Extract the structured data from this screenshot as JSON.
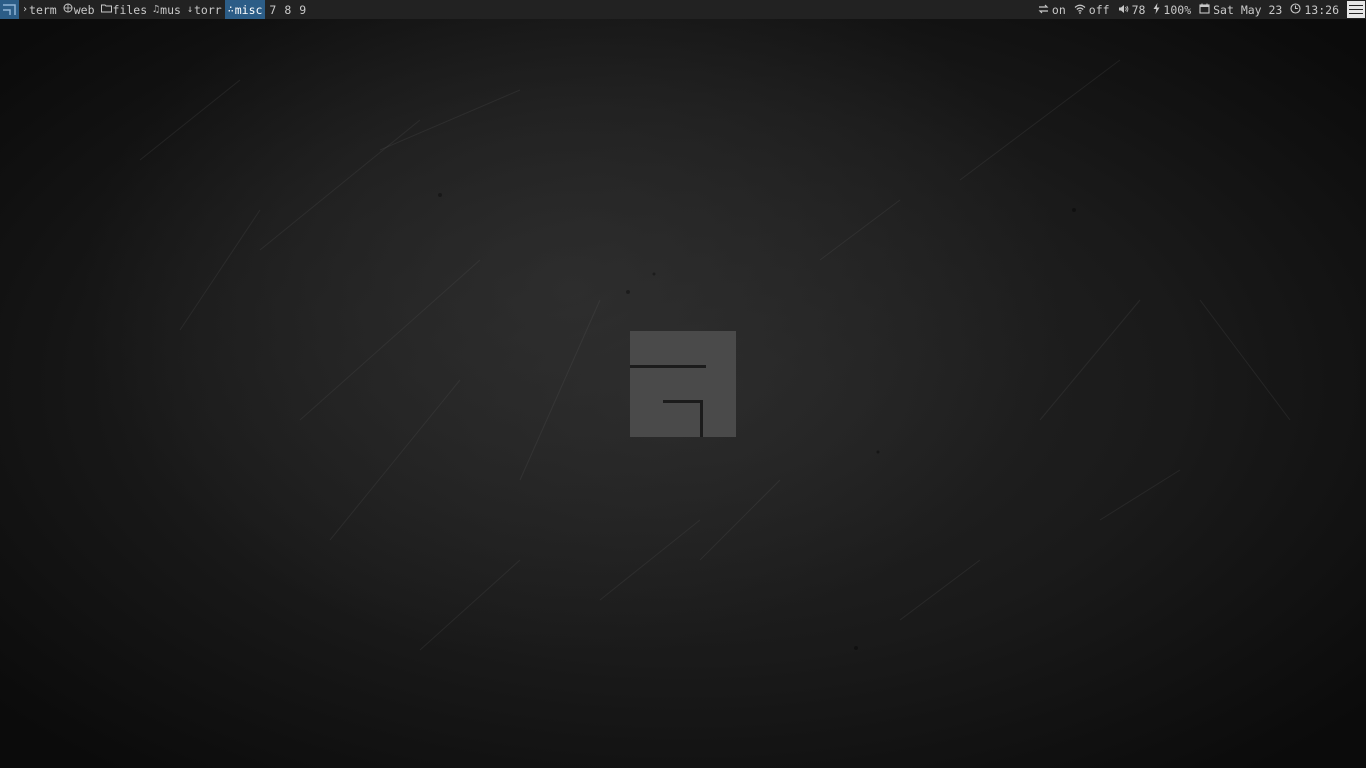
{
  "taskbar": {
    "tags": [
      {
        "label": "term",
        "icon": "terminal-icon",
        "glyph": "›",
        "active": false
      },
      {
        "label": "web",
        "icon": "globe-icon",
        "glyph": "🌐",
        "active": false
      },
      {
        "label": "files",
        "icon": "folder-icon",
        "glyph": "🗁",
        "active": false
      },
      {
        "label": "mus",
        "icon": "music-icon",
        "glyph": "♫",
        "active": false
      },
      {
        "label": "torr",
        "icon": "download-icon",
        "glyph": "↓",
        "active": false
      },
      {
        "label": "misc",
        "icon": "misc-icon",
        "glyph": "∴",
        "active": true
      },
      {
        "label": "7"
      },
      {
        "label": "8"
      },
      {
        "label": "9"
      }
    ],
    "status": {
      "network": {
        "icon": "network-icon",
        "value": "on"
      },
      "wifi": {
        "icon": "wifi-icon",
        "value": "off"
      },
      "volume": {
        "icon": "volume-icon",
        "value": "78"
      },
      "battery": {
        "icon": "battery-bolt-icon",
        "value": "100%"
      },
      "date": {
        "icon": "calendar-icon",
        "value": "Sat May 23"
      },
      "time": {
        "icon": "clock-icon",
        "value": "13:26"
      }
    },
    "layout_icon": "tile-layout-icon",
    "float_icon": "floating-layout-icon"
  },
  "desktop": {
    "wallpaper": "dark scratched metal texture",
    "logo": "awesome-wm-logo"
  },
  "colors": {
    "bar_bg": "#222222",
    "accent": "#2c5d87",
    "text": "#c8c8c8",
    "logo": "#4a4a4a"
  }
}
